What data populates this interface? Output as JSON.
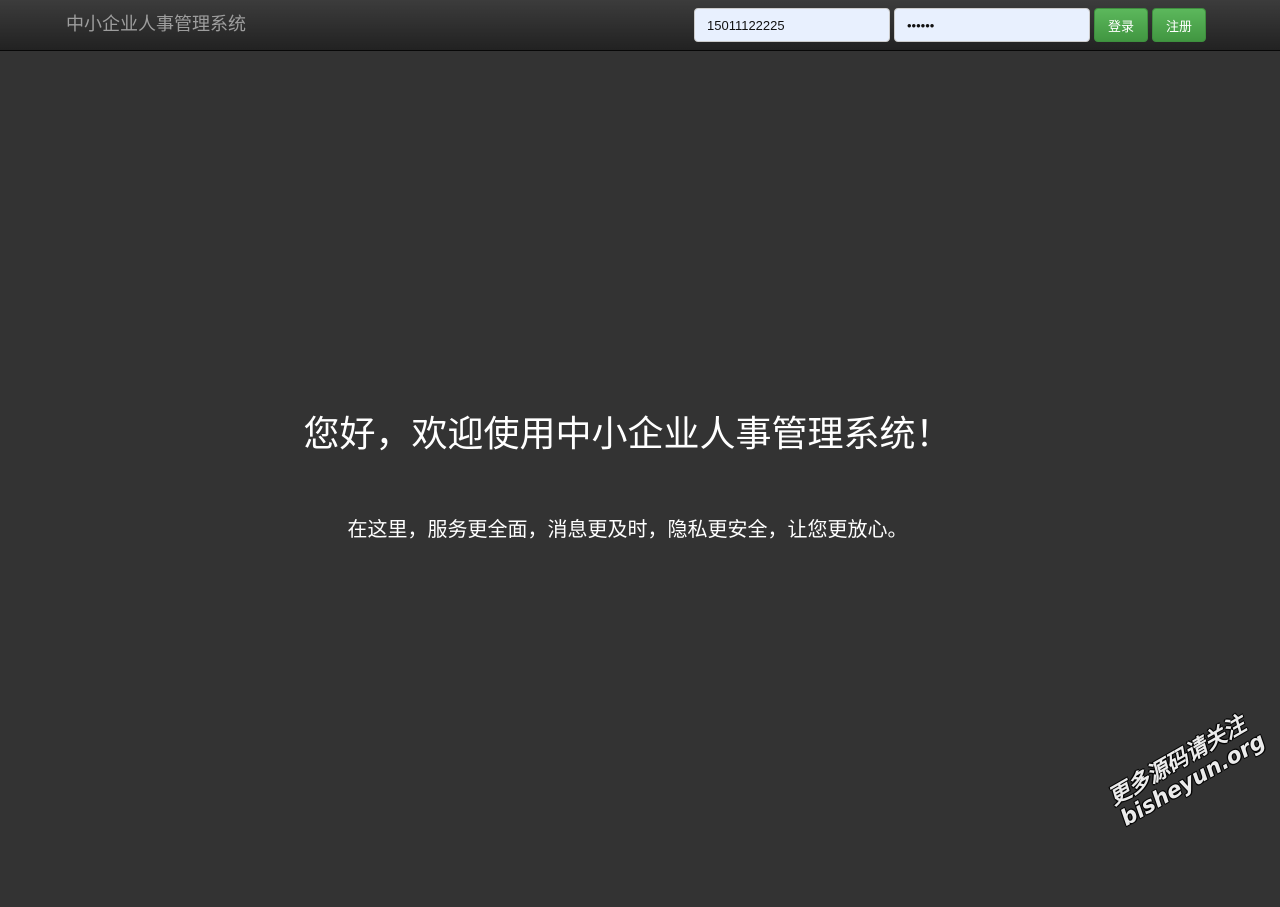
{
  "navbar": {
    "brand": "中小企业人事管理系统",
    "username_value": "15011122225",
    "password_value": "••••••",
    "login_label": "登录",
    "register_label": "注册"
  },
  "hero": {
    "title": "您好，欢迎使用中小企业人事管理系统！",
    "subtitle": "在这里，服务更全面，消息更及时，隐私更安全，让您更放心。"
  },
  "watermark": {
    "line1": "更多源码请关注",
    "line2": "bisheyun.org"
  }
}
